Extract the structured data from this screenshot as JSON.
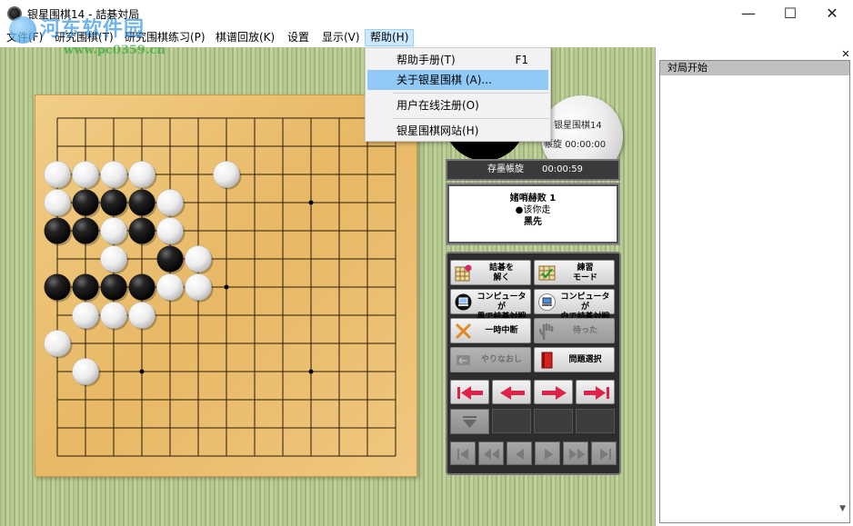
{
  "window": {
    "title": "银星围棋14 - 詰碁対局",
    "minimize_glyph": "—",
    "maximize_glyph": "☐",
    "close_glyph": "✕"
  },
  "watermark": {
    "text": "河东软件园",
    "url": "www.pc0359.cn"
  },
  "menubar": {
    "items": [
      {
        "label": "文件(F)"
      },
      {
        "label": "研究围棋(T)"
      },
      {
        "label": "研究围棋练习(P)"
      },
      {
        "label": "棋谱回放(K)"
      },
      {
        "label": "设置"
      },
      {
        "label": "显示(V)"
      },
      {
        "label": "帮助(H)"
      }
    ]
  },
  "help_menu": {
    "items": [
      {
        "label": "帮助手册(T)",
        "shortcut": "F1"
      },
      {
        "label": "关于银星围棋 (A)...",
        "highlighted": true
      },
      {
        "label": "用户在线注册(O)"
      },
      {
        "label": "银星围棋网站(H)"
      }
    ]
  },
  "players": {
    "white": {
      "name": "银星围棋14",
      "time_label": "帳旋",
      "time": "00:00:00"
    },
    "black": {
      "time_label": "存墨帳旋",
      "time": "00:00:59"
    }
  },
  "status": {
    "line1": "媎哨赫败 1",
    "line2": "●该你走",
    "line3": "黑先"
  },
  "controls": {
    "solve": {
      "l1": "詰碁を",
      "l2": "解く"
    },
    "practice": {
      "l1": "練習",
      "l2": "モード"
    },
    "cpu_black": {
      "l1": "コンピュータが",
      "l2": "黒で詰碁対戦"
    },
    "cpu_white": {
      "l1": "コンピュータが",
      "l2": "白で詰碁対戦"
    },
    "pause": {
      "l1": "一時中断"
    },
    "wait": {
      "l1": "待った"
    },
    "redo": {
      "l1": "やりなおし"
    },
    "problem_select": {
      "l1": "問題選択"
    }
  },
  "move_list": {
    "first_row": "対局开始"
  },
  "colors": {
    "menu_open": "#cce8ff",
    "menu_highlight": "#91c9f7",
    "nav_arrow": "#e0224a",
    "board": "#e9bc6c",
    "tatami": "#b0c48b"
  },
  "board": {
    "size": 13,
    "star_points": [
      [
        3,
        3
      ],
      [
        3,
        9
      ],
      [
        9,
        3
      ],
      [
        9,
        9
      ],
      [
        6,
        6
      ]
    ],
    "stones": [
      {
        "c": 0,
        "r": 2,
        "color": "white"
      },
      {
        "c": 1,
        "r": 2,
        "color": "white"
      },
      {
        "c": 2,
        "r": 2,
        "color": "white"
      },
      {
        "c": 3,
        "r": 2,
        "color": "white"
      },
      {
        "c": 6,
        "r": 2,
        "color": "white"
      },
      {
        "c": 0,
        "r": 3,
        "color": "white"
      },
      {
        "c": 1,
        "r": 3,
        "color": "black"
      },
      {
        "c": 2,
        "r": 3,
        "color": "black"
      },
      {
        "c": 3,
        "r": 3,
        "color": "black"
      },
      {
        "c": 4,
        "r": 3,
        "color": "white"
      },
      {
        "c": 0,
        "r": 4,
        "color": "black"
      },
      {
        "c": 1,
        "r": 4,
        "color": "black"
      },
      {
        "c": 2,
        "r": 4,
        "color": "white"
      },
      {
        "c": 3,
        "r": 4,
        "color": "black"
      },
      {
        "c": 4,
        "r": 4,
        "color": "white"
      },
      {
        "c": 2,
        "r": 5,
        "color": "white"
      },
      {
        "c": 4,
        "r": 5,
        "color": "black"
      },
      {
        "c": 5,
        "r": 5,
        "color": "white"
      },
      {
        "c": 0,
        "r": 6,
        "color": "black"
      },
      {
        "c": 1,
        "r": 6,
        "color": "black"
      },
      {
        "c": 2,
        "r": 6,
        "color": "black"
      },
      {
        "c": 3,
        "r": 6,
        "color": "black"
      },
      {
        "c": 4,
        "r": 6,
        "color": "white"
      },
      {
        "c": 5,
        "r": 6,
        "color": "white"
      },
      {
        "c": 1,
        "r": 7,
        "color": "white"
      },
      {
        "c": 2,
        "r": 7,
        "color": "white"
      },
      {
        "c": 3,
        "r": 7,
        "color": "white"
      },
      {
        "c": 0,
        "r": 8,
        "color": "white"
      },
      {
        "c": 1,
        "r": 9,
        "color": "white"
      }
    ]
  }
}
